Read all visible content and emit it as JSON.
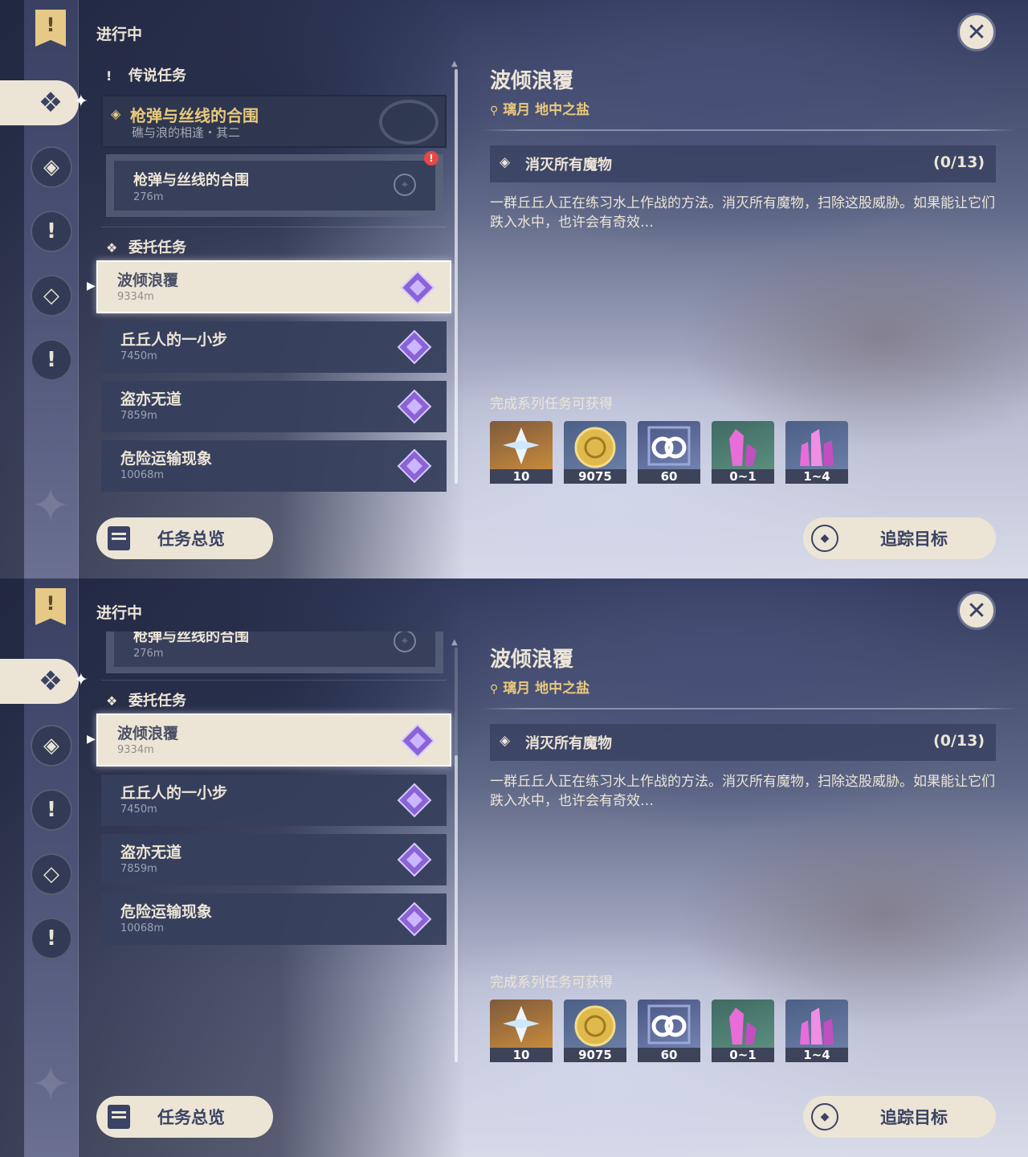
{
  "panels": [
    {
      "status_title": "进行中",
      "legend_section": {
        "header": "传说任务",
        "quest_title": "枪弹与丝线的合围",
        "quest_subtitle": "礁与浪的相逢・其二",
        "sub_quest": {
          "title": "枪弹与丝线的合围",
          "distance": "276m",
          "alert": "!"
        }
      },
      "commission_section": {
        "header": "委托任务",
        "quests": [
          {
            "title": "波倾浪覆",
            "distance": "9334m",
            "selected": true
          },
          {
            "title": "丘丘人的一小步",
            "distance": "7450m",
            "selected": false
          },
          {
            "title": "盗亦无道",
            "distance": "7859m",
            "selected": false
          },
          {
            "title": "危险运输现象",
            "distance": "10068m",
            "selected": false
          }
        ]
      }
    },
    {
      "status_title": "进行中",
      "legend_section": {
        "partial_sub_quest": {
          "title": "枪弹与丝线的合围",
          "distance": "276m"
        }
      },
      "commission_section": {
        "header": "委托任务",
        "quests": [
          {
            "title": "波倾浪覆",
            "distance": "9334m",
            "selected": true
          },
          {
            "title": "丘丘人的一小步",
            "distance": "7450m",
            "selected": false
          },
          {
            "title": "盗亦无道",
            "distance": "7859m",
            "selected": false
          },
          {
            "title": "危险运输现象",
            "distance": "10068m",
            "selected": false
          }
        ]
      }
    }
  ],
  "detail": {
    "title": "波倾浪覆",
    "location": "璃月 地中之盐",
    "objective": {
      "text": "消灭所有魔物",
      "count": "(0/13)"
    },
    "description": "一群丘丘人正在练习水上作战的方法。消灭所有魔物，扫除这股威胁。如果能让它们跌入水中，也许会有奇效…",
    "rewards_header": "完成系列任务可获得",
    "rewards": [
      {
        "name": "primogem-icon",
        "qty": "10"
      },
      {
        "name": "mora-icon",
        "qty": "9075"
      },
      {
        "name": "exp-icon",
        "qty": "60"
      },
      {
        "name": "crystal-icon",
        "qty": "0~1"
      },
      {
        "name": "crystal-cluster-icon",
        "qty": "1~4"
      }
    ]
  },
  "buttons": {
    "overview": "任务总览",
    "track": "追踪目标",
    "close": "✕"
  },
  "colors": {
    "cream": "#ece5d6",
    "gold": "#e9c97c",
    "navy": "#3b4263",
    "commission_gem": "#8a63d6"
  }
}
